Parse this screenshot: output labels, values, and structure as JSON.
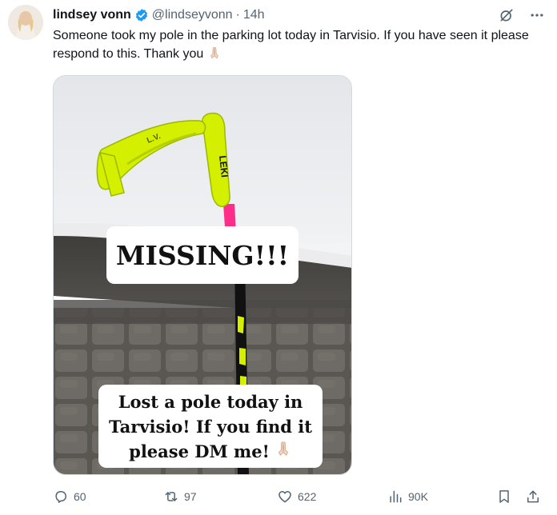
{
  "author": {
    "display_name": "lindsey vonn",
    "handle": "@lindseyvonn",
    "separator": "·",
    "time": "14h",
    "verified_color": "#1d9bf0"
  },
  "tweet": {
    "text": "Someone took my pole in the parking lot today in Tarvisio. If you have seen it please respond to this. Thank you"
  },
  "media": {
    "caption_top": "MISSING!!!",
    "caption_bottom_lines": [
      "Lost a pole today in",
      "Tarvisio! If you find it",
      "please DM me!"
    ],
    "grip_text": "LEKI",
    "strap_text": "L.V."
  },
  "actions": {
    "replies": "60",
    "reposts": "97",
    "likes": "622",
    "views": "90K"
  },
  "icons": {
    "top": [
      "grok-icon",
      "more-icon"
    ],
    "actions": [
      "reply-icon",
      "repost-icon",
      "like-icon",
      "views-icon",
      "bookmark-icon",
      "share-icon"
    ]
  },
  "colors": {
    "text": "#0f1419",
    "secondary": "#536471",
    "accent": "#1d9bf0",
    "pole_yellow": "#d4f000",
    "pole_pink": "#ff2d8a"
  }
}
